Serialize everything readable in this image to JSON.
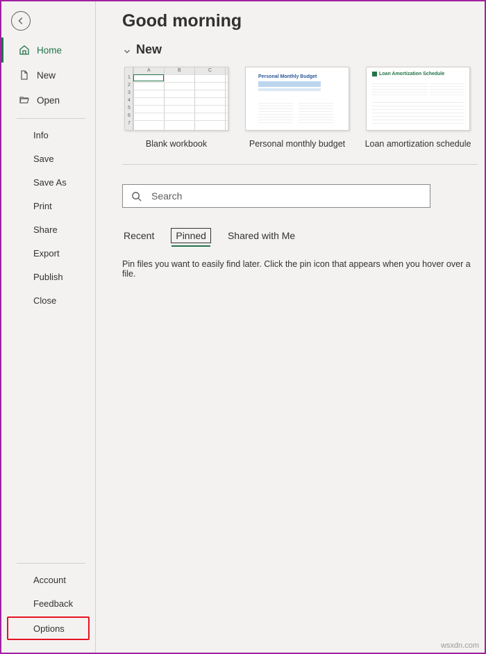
{
  "header": {
    "title": "Good morning"
  },
  "sidebar": {
    "primary": [
      {
        "label": "Home",
        "icon": "home-icon",
        "active": true
      },
      {
        "label": "New",
        "icon": "file-icon"
      },
      {
        "label": "Open",
        "icon": "folder-open-icon"
      }
    ],
    "secondary": [
      {
        "label": "Info"
      },
      {
        "label": "Save"
      },
      {
        "label": "Save As"
      },
      {
        "label": "Print"
      },
      {
        "label": "Share"
      },
      {
        "label": "Export"
      },
      {
        "label": "Publish"
      },
      {
        "label": "Close"
      }
    ],
    "bottom": [
      {
        "label": "Account"
      },
      {
        "label": "Feedback"
      },
      {
        "label": "Options",
        "highlight": true
      }
    ]
  },
  "new_section": {
    "heading": "New",
    "templates": [
      {
        "label": "Blank workbook",
        "kind": "blank"
      },
      {
        "label": "Personal monthly budget",
        "kind": "budget",
        "thumb_title": "Personal Monthly Budget"
      },
      {
        "label": "Loan amortization schedule",
        "kind": "loan",
        "thumb_title": "Loan Amortization Schedule"
      }
    ]
  },
  "search": {
    "placeholder": "Search"
  },
  "tabs": {
    "items": [
      {
        "label": "Recent"
      },
      {
        "label": "Pinned",
        "selected": true
      },
      {
        "label": "Shared with Me"
      }
    ],
    "pinned_hint": "Pin files you want to easily find later. Click the pin icon that appears when you hover over a file."
  },
  "watermark": "wsxdn.com"
}
